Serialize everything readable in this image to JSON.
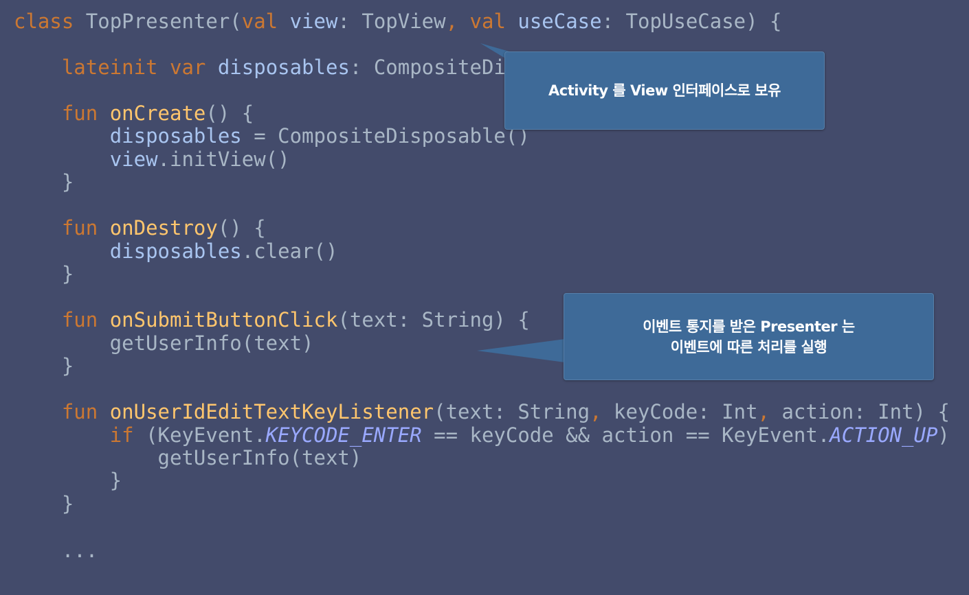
{
  "colors": {
    "background": "#434b6b",
    "keyword": "#cc7832",
    "function": "#ffc66d",
    "property": "#a9c5f0",
    "plain": "#a9b7c6",
    "constant_italic": "#9aa9ff",
    "callout": "#3e6a98"
  },
  "code": {
    "l1": {
      "kw1": "class",
      "t1": " TopPresenter(",
      "kw2": "val",
      "p1": " view",
      "t2": ": TopView",
      "kw3": ",",
      "t3": " ",
      "kw4": "val",
      "p2": " useCase",
      "t4": ": TopUseCase) {"
    },
    "l2": {
      "indent": "    ",
      "kw1": "lateinit",
      "t1": " ",
      "kw2": "var",
      "p1": " disposables",
      "t2": ": CompositeDi"
    },
    "l3": {
      "indent": "    ",
      "kw1": "fun",
      "t1": " ",
      "fn": "onCreate",
      "t2": "() {"
    },
    "l4": {
      "indent": "        ",
      "p1": "disposables",
      "t1": " = CompositeDisposable()"
    },
    "l5": {
      "indent": "        ",
      "p1": "view",
      "t1": ".initView()"
    },
    "l6": {
      "text": "    }"
    },
    "l7": {
      "indent": "    ",
      "kw1": "fun",
      "t1": " ",
      "fn": "onDestroy",
      "t2": "() {"
    },
    "l8": {
      "indent": "        ",
      "p1": "disposables",
      "t1": ".clear()"
    },
    "l9": {
      "text": "    }"
    },
    "l10": {
      "indent": "    ",
      "kw1": "fun",
      "t1": " ",
      "fn": "onSubmitButtonClick",
      "t2": "(text: String) {"
    },
    "l11": {
      "text": "        getUserInfo(text)"
    },
    "l12": {
      "text": "    }"
    },
    "l13": {
      "indent": "    ",
      "kw1": "fun",
      "t1": " ",
      "fn": "onUserIdEditTextKeyListener",
      "t2": "(text: String",
      "kw2": ",",
      "t3": " keyCode: Int",
      "kw3": ",",
      "t4": " action: Int) {"
    },
    "l14": {
      "indent": "        ",
      "kw1": "if",
      "t1": " (KeyEvent.",
      "it1": "KEYCODE_ENTER",
      "t2": " == keyCode && action == KeyEvent.",
      "it2": "ACTION_UP",
      "t3": ")"
    },
    "l15": {
      "text": "            getUserInfo(text)"
    },
    "l16": {
      "text": "        }"
    },
    "l17": {
      "text": "    }"
    },
    "l18": {
      "text": "    ..."
    }
  },
  "callouts": {
    "first": {
      "line1": "Activity 를 View 인터페이스로 보유"
    },
    "second": {
      "line1": "이벤트 통지를 받은 Presenter 는",
      "line2": "이벤트에 따른 처리를 실행"
    }
  }
}
